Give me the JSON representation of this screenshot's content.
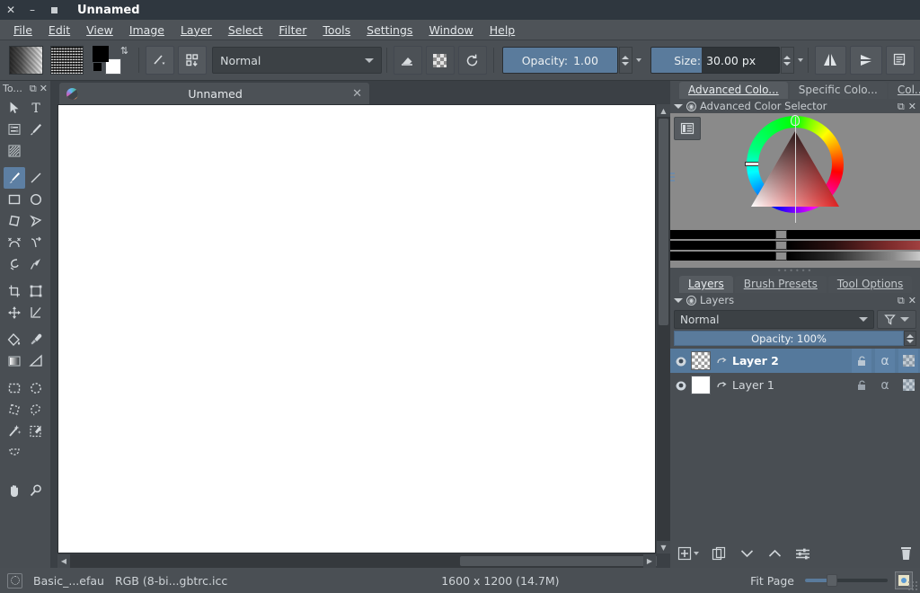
{
  "window": {
    "title": "Unnamed",
    "close_glyph": "✕",
    "minimize_glyph": "–",
    "maximize_glyph": ""
  },
  "menubar": {
    "items": [
      {
        "label": "File",
        "accel": "F"
      },
      {
        "label": "Edit",
        "accel": "E"
      },
      {
        "label": "View",
        "accel": "V"
      },
      {
        "label": "Image",
        "accel": "I"
      },
      {
        "label": "Layer",
        "accel": "L"
      },
      {
        "label": "Select",
        "accel": "S"
      },
      {
        "label": "Filter",
        "accel": "r"
      },
      {
        "label": "Tools",
        "accel": "T"
      },
      {
        "label": "Settings",
        "accel": "n"
      },
      {
        "label": "Window",
        "accel": "W"
      },
      {
        "label": "Help",
        "accel": "H"
      }
    ]
  },
  "toolbar": {
    "gradient_label": "gradient-swatch",
    "pattern_label": "pattern-swatch",
    "fg_color": "#000000",
    "bg_color": "#ffffff",
    "blend_mode": "Normal",
    "opacity_label": "Opacity:",
    "opacity_value": "1.00",
    "size_label": "Size:",
    "size_value": "30.00 px",
    "eraser_tooltip": "Eraser",
    "alpha_tooltip": "Preserve Alpha",
    "reset_tooltip": "Reset",
    "mirror_h_tooltip": "Horizontal Mirror",
    "mirror_v_tooltip": "Vertical Mirror",
    "workspace_tooltip": "Choose Workspace"
  },
  "toolbox": {
    "title": "To...",
    "float_glyph": "⧉",
    "close_glyph": "✕",
    "tools": [
      {
        "name": "select-shapes-tool",
        "row": 0
      },
      {
        "name": "text-tool",
        "row": 0
      },
      {
        "name": "edit-shapes-tool",
        "row": 1
      },
      {
        "name": "calligraphy-tool",
        "row": 1
      },
      {
        "name": "gradient-edit-tool",
        "row": 2
      },
      {
        "name": "freehand-brush-tool",
        "row": 3,
        "selected": true
      },
      {
        "name": "line-tool",
        "row": 3
      },
      {
        "name": "rectangle-tool",
        "row": 4
      },
      {
        "name": "ellipse-tool",
        "row": 4
      },
      {
        "name": "polygon-tool",
        "row": 5
      },
      {
        "name": "polyline-tool",
        "row": 5
      },
      {
        "name": "bezier-curve-tool",
        "row": 6
      },
      {
        "name": "freehand-path-tool",
        "row": 6
      },
      {
        "name": "dynamic-brush-tool",
        "row": 7
      },
      {
        "name": "multibrush-tool",
        "row": 7
      },
      {
        "name": "crop-tool",
        "row": 8
      },
      {
        "name": "transform-tool",
        "row": 8
      },
      {
        "name": "move-tool",
        "row": 9
      },
      {
        "name": "measure-tool",
        "row": 9
      },
      {
        "name": "fill-tool",
        "row": 10
      },
      {
        "name": "color-picker-tool",
        "row": 10
      },
      {
        "name": "gradient-tool",
        "row": 11
      },
      {
        "name": "perspective-grid-tool",
        "row": 11
      },
      {
        "name": "rectangular-selection-tool",
        "row": 12
      },
      {
        "name": "elliptical-selection-tool",
        "row": 12
      },
      {
        "name": "polygonal-selection-tool",
        "row": 13
      },
      {
        "name": "freehand-selection-tool",
        "row": 13
      },
      {
        "name": "magic-wand-selection-tool",
        "row": 14
      },
      {
        "name": "similar-color-selection-tool",
        "row": 14
      },
      {
        "name": "bezier-selection-tool",
        "row": 15
      },
      {
        "name": "pan-tool",
        "row": 16
      },
      {
        "name": "zoom-tool",
        "row": 16
      }
    ]
  },
  "document": {
    "tab_title": "Unnamed",
    "tab_close_glyph": "✕"
  },
  "right_dock": {
    "color_tabs": [
      {
        "label": "Advanced Colo...",
        "accel": "A",
        "active": true
      },
      {
        "label": "Specific Colo...",
        "accel": "",
        "active": false
      },
      {
        "label": "Col...",
        "accel": "C",
        "active": false
      }
    ],
    "color_panel_title": "Advanced Color Selector",
    "color_panel_accel": "A",
    "float_glyph": "⧉",
    "close_glyph": "✕",
    "layer_tabs": [
      {
        "label": "Layers",
        "accel": "y",
        "active": true
      },
      {
        "label": "Brush Presets",
        "accel": "B",
        "active": false
      },
      {
        "label": "Tool Options",
        "accel": "O",
        "active": false
      }
    ],
    "layers_panel_title": "Layers",
    "layers_panel_accel": "y",
    "blend_mode": "Normal",
    "opacity_text": "Opacity:  100%",
    "layers": [
      {
        "name": "Layer 2",
        "thumb": "checker",
        "visible": true,
        "selected": true,
        "locked": false,
        "alpha_glyph": "α"
      },
      {
        "name": "Layer 1",
        "thumb": "white",
        "visible": true,
        "selected": false,
        "locked": false,
        "alpha_glyph": "α"
      }
    ],
    "layer_toolbar": [
      {
        "name": "add-layer-button",
        "glyph": "+"
      },
      {
        "name": "duplicate-layer-button",
        "glyph": "⧉"
      },
      {
        "name": "move-layer-down-button",
        "glyph": "∨"
      },
      {
        "name": "move-layer-up-button",
        "glyph": "∧"
      },
      {
        "name": "layer-properties-button",
        "glyph": "≡"
      },
      {
        "name": "delete-layer-button",
        "glyph": "🗑"
      }
    ]
  },
  "statusbar": {
    "brush_preset": "Basic_...efau",
    "color_profile": "RGB (8-bi...gbtrc.icc",
    "image_size": "1600 x 1200 (14.7M)",
    "zoom_label": "Fit Page",
    "zoom_thumbnail_name": "canvas-overview-button"
  },
  "colors": {
    "accent_blue": "#5a7b9c",
    "panel_bg": "#494e53",
    "toolbar_bg": "#4a4f54",
    "menubar_bg": "#4e5358",
    "titlebar_bg": "#2f373f",
    "canvas_bg": "#ffffff",
    "selection_blue": "#55799c"
  }
}
